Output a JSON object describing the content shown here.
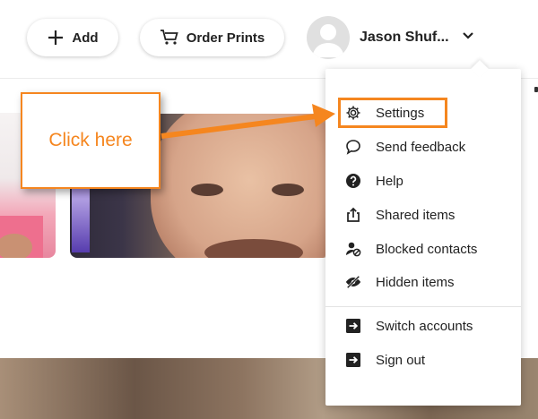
{
  "toolbar": {
    "add_label": "Add",
    "order_prints_label": "Order Prints"
  },
  "account": {
    "username": "Jason Shuf..."
  },
  "callout": {
    "text": "Click here"
  },
  "menu": {
    "items": [
      {
        "label": "Settings",
        "icon": "gear-icon"
      },
      {
        "label": "Send feedback",
        "icon": "feedback-bubble-icon"
      },
      {
        "label": "Help",
        "icon": "help-icon"
      },
      {
        "label": "Shared items",
        "icon": "share-icon"
      },
      {
        "label": "Blocked contacts",
        "icon": "blocked-contact-icon"
      },
      {
        "label": "Hidden items",
        "icon": "hidden-eye-icon"
      },
      {
        "label": "Switch accounts",
        "icon": "switch-account-icon"
      },
      {
        "label": "Sign out",
        "icon": "sign-out-icon"
      }
    ]
  },
  "colors": {
    "annotation": "#f5861f",
    "text": "#222222"
  }
}
